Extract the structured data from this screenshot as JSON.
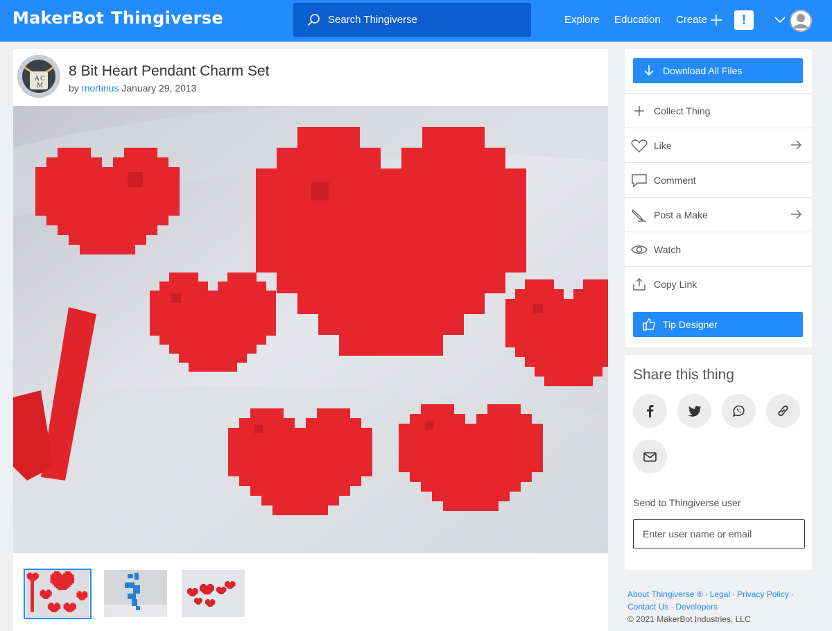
{
  "header": {
    "logo_brand": "MakerBot",
    "logo_product": "Thingiverse",
    "search_placeholder": "Search Thingiverse",
    "nav": {
      "explore": "Explore",
      "education": "Education",
      "create": "Create"
    },
    "alert_label": "!",
    "colors": {
      "bar": "#248bfb",
      "search": "#0d5ed0"
    }
  },
  "thing": {
    "title": "8 Bit Heart Pendant Charm Set",
    "by": "by",
    "author": "mortinus",
    "date": "January 29, 2013",
    "author_avatar_text": [
      "A",
      "C",
      "M"
    ],
    "photo_description_icon": "red-pixel-hearts-photo",
    "thumbnails": [
      "red-hearts-thumb",
      "blue-parts-thumb",
      "red-hearts-scatter-thumb"
    ]
  },
  "actions": {
    "download": "Download All Files",
    "collect": "Collect Thing",
    "like": "Like",
    "comment": "Comment",
    "post_make": "Post a Make",
    "watch": "Watch",
    "copy_link": "Copy Link",
    "tip": "Tip Designer"
  },
  "share": {
    "title": "Share this thing",
    "networks": [
      "facebook",
      "twitter",
      "whatsapp",
      "link",
      "email"
    ],
    "send_label": "Send to Thingiverse user",
    "send_placeholder": "Enter user name or email"
  },
  "footer": {
    "about": "About Thingiverse ®",
    "legal": "Legal",
    "privacy": "Privacy Policy",
    "contact": "Contact Us",
    "developers": "Developers",
    "copyright": "© 2021 MakerBot Industries, LLC",
    "sep": "·"
  }
}
